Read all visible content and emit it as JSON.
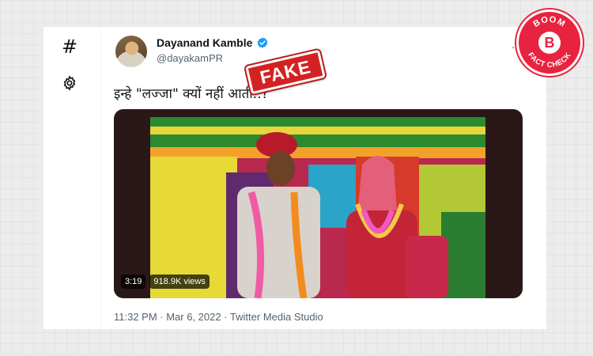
{
  "sidebar": {
    "items": [
      {
        "icon": "hash-icon",
        "label": "#"
      },
      {
        "icon": "gear-icon"
      }
    ]
  },
  "tweet": {
    "author": {
      "name": "Dayanand Kamble",
      "handle": "@dayakamPR",
      "verified": true
    },
    "more_label": "...",
    "text": "इन्हे \"लज्जा\" क्यों नहीं आती..?",
    "media": {
      "duration": "3:19",
      "views": "918.9K views"
    },
    "timestamp": "11:32 PM · Mar 6, 2022 · Twitter Media Studio"
  },
  "overlay": {
    "stamp": "FAKE",
    "badge_top": "BOOM",
    "badge_bottom": "FACT CHECK",
    "badge_letter": "B"
  },
  "colors": {
    "verified": "#1d9bf0",
    "stamp": "#d42222",
    "badge": "#e8233f",
    "muted_text": "#536471"
  }
}
